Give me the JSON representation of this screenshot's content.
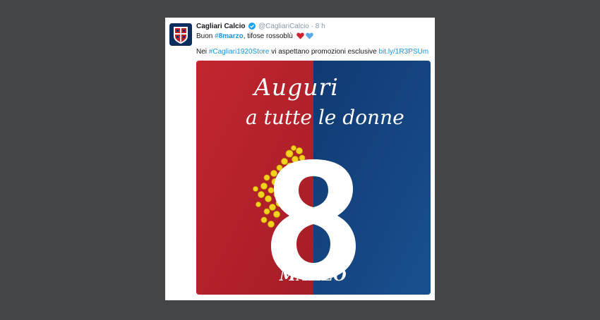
{
  "tweet": {
    "display_name": "Cagliari Calcio",
    "handle": "@CagliariCalcio",
    "separator": "·",
    "time": "8 h",
    "line1_prefix": "Buon ",
    "line1_hash": "#",
    "line1_tag": "8marzo",
    "line1_suffix": ", tifose rossoblù",
    "line2_prefix": "Nei ",
    "line2_hashtag": "#Cagliari1920Store",
    "line2_middle": " vi aspettano promozioni esclusive ",
    "line2_link": "bit.ly/1R3PSUm"
  },
  "image": {
    "line1": "Auguri",
    "line2": "a tutte le donne",
    "number": "8",
    "month": "MARZO"
  },
  "colors": {
    "background": "#444546",
    "red": "#b8222c",
    "blue": "#123f78",
    "link": "#1b95e0",
    "mimosa": "#f2d31c"
  },
  "icons": {
    "verified": "verified-badge-icon",
    "red_heart": "red-heart-icon",
    "blue_heart": "blue-heart-icon",
    "avatar": "cagliari-crest-icon"
  }
}
